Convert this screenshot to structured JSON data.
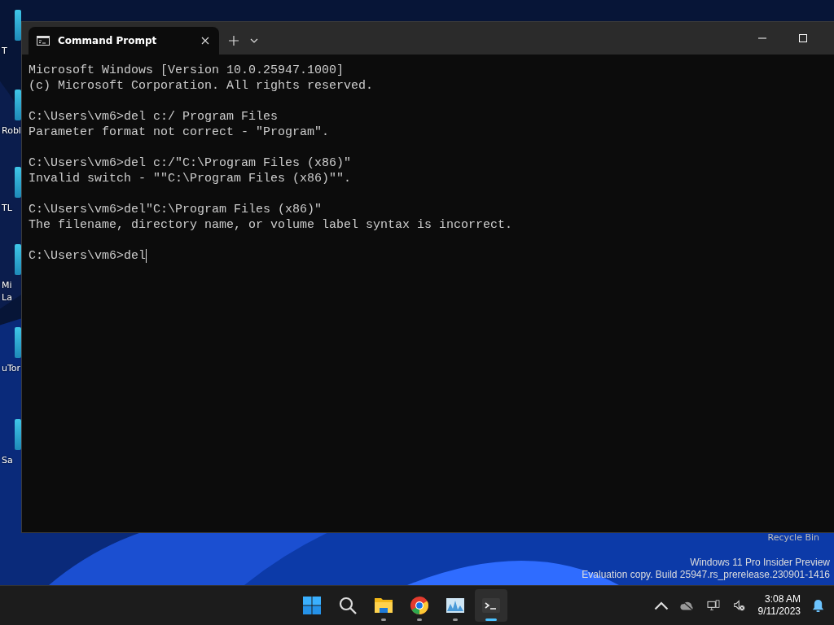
{
  "desktop": {
    "icons": [
      {
        "label": "T"
      },
      {
        "label": "Robl"
      },
      {
        "label": "TL"
      },
      {
        "label": "Mi\nLa"
      },
      {
        "label": "uTor"
      },
      {
        "label": "Sa"
      }
    ],
    "recycle_bin": "Recycle Bin",
    "watermark": [
      "Windows 11 Pro Insider Preview",
      "Evaluation copy. Build 25947.rs_prerelease.230901-1416"
    ]
  },
  "window": {
    "tab": {
      "title": "Command Prompt",
      "selected": true
    },
    "blocks": [
      [
        "Microsoft Windows [Version 10.0.25947.1000]",
        "(c) Microsoft Corporation. All rights reserved."
      ],
      [
        "C:\\Users\\vm6>del c:/ Program Files",
        "Parameter format not correct - \"Program\"."
      ],
      [
        "C:\\Users\\vm6>del c:/\"C:\\Program Files (x86)\"",
        "Invalid switch - \"\"C:\\Program Files (x86)\"\"."
      ],
      [
        "C:\\Users\\vm6>del\"C:\\Program Files (x86)\"",
        "The filename, directory name, or volume label syntax is incorrect."
      ],
      [
        "C:\\Users\\vm6>del"
      ]
    ]
  },
  "taskbar": {
    "apps": [
      {
        "kind": "start",
        "active": false
      },
      {
        "kind": "search",
        "active": false
      },
      {
        "kind": "folder",
        "running": true,
        "active": false
      },
      {
        "kind": "browser",
        "running": true,
        "active": false
      },
      {
        "kind": "monitor",
        "running": true,
        "active": false
      },
      {
        "kind": "terminal",
        "running": true,
        "active": true
      }
    ],
    "time": "3:08 AM",
    "date": "9/11/2023"
  }
}
